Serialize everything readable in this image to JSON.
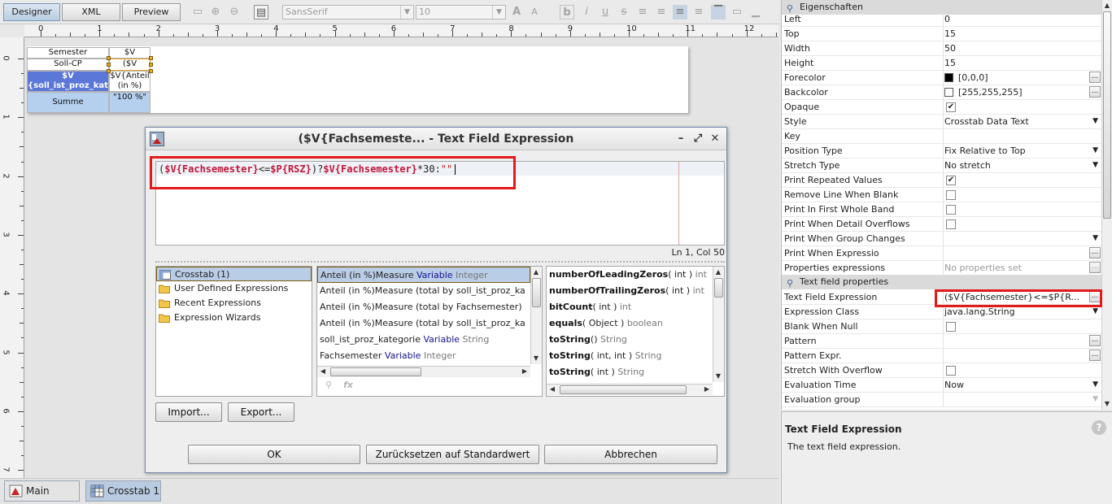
{
  "designer_tabs": [
    "Designer",
    "XML",
    "Preview"
  ],
  "toolbar": {
    "font_family": "SansSerif",
    "font_size": "10"
  },
  "ruler": {
    "h": [
      "0",
      "1",
      "2",
      "3",
      "4",
      "5",
      "6",
      "7",
      "8",
      "9",
      "10",
      "11",
      "12"
    ],
    "v": [
      "0",
      "1",
      "2",
      "3",
      "4",
      "5",
      "6",
      "7"
    ]
  },
  "crosstab": {
    "row1_label": "Semester",
    "row1_value": "$V",
    "row2_label": "Soll-CP",
    "row2_value": "($V",
    "row3_label_a": "$V",
    "row3_label_b": "{soll_ist_proz_kate",
    "row3_value_a": "$V{Anteil",
    "row3_value_b": "(in %)",
    "row4_label": "Summe",
    "row4_value": "\"100 %\""
  },
  "dialog": {
    "title": "($V{Fachsemeste... - Text Field Expression",
    "code": [
      {
        "t": "(",
        "c": "op"
      },
      {
        "t": "$V{Fachsemester}",
        "c": "var"
      },
      {
        "t": "<=",
        "c": "op"
      },
      {
        "t": "$P{RSZ}",
        "c": "var"
      },
      {
        "t": ")?",
        "c": "op"
      },
      {
        "t": "$V{Fachsemester}",
        "c": "var"
      },
      {
        "t": "*30:",
        "c": "op"
      },
      {
        "t": "\"\"",
        "c": "str"
      }
    ],
    "status": "Ln 1, Col 50",
    "tree": [
      "Crosstab (1)",
      "User Defined Expressions",
      "Recent Expressions",
      "Expression Wizards"
    ],
    "variables": [
      {
        "name": "Anteil (in %)Measure",
        "kind": "Variable",
        "type": "Integer"
      },
      {
        "name": "Anteil (in %)Measure (total by soll_ist_proz_ka",
        "kind": "",
        "type": ""
      },
      {
        "name": "Anteil (in %)Measure (total by Fachsemester)",
        "kind": "",
        "type": ""
      },
      {
        "name": "Anteil (in %)Measure (total by soll_ist_proz_ka",
        "kind": "",
        "type": ""
      },
      {
        "name": "soll_ist_proz_kategorie",
        "kind": "Variable",
        "type": "String"
      },
      {
        "name": "Fachsemester",
        "kind": "Variable",
        "type": "Integer"
      }
    ],
    "methods": [
      {
        "name": "numberOfLeadingZeros",
        "args": "( int )",
        "ret": "int"
      },
      {
        "name": "numberOfTrailingZeros",
        "args": "( int )",
        "ret": "int"
      },
      {
        "name": "bitCount",
        "args": "( int )",
        "ret": "int"
      },
      {
        "name": "equals",
        "args": "( Object )",
        "ret": "boolean"
      },
      {
        "name": "toString",
        "args": "()",
        "ret": "String"
      },
      {
        "name": "toString",
        "args": "( int, int )",
        "ret": "String"
      },
      {
        "name": "toString",
        "args": "( int )",
        "ret": "String"
      }
    ],
    "import_label": "Import...",
    "export_label": "Export...",
    "ok_label": "OK",
    "reset_label": "Zurücksetzen auf Standardwert",
    "cancel_label": "Abbrechen"
  },
  "doc_tabs": [
    "Main report",
    "Crosstab 1"
  ],
  "properties": {
    "section_title": "Eigenschaften",
    "rows": [
      {
        "name": "Left",
        "value": "0",
        "kind": "text"
      },
      {
        "name": "Top",
        "value": "15",
        "kind": "text"
      },
      {
        "name": "Width",
        "value": "50",
        "kind": "text"
      },
      {
        "name": "Height",
        "value": "15",
        "kind": "text"
      },
      {
        "name": "Forecolor",
        "value": "[0,0,0]",
        "kind": "color",
        "swatch": "#000000"
      },
      {
        "name": "Backcolor",
        "value": "[255,255,255]",
        "kind": "color",
        "swatch": "#ffffff"
      },
      {
        "name": "Opaque",
        "value": "",
        "kind": "check",
        "checked": true
      },
      {
        "name": "Style",
        "value": "Crosstab Data Text",
        "kind": "combo"
      },
      {
        "name": "Key",
        "value": "",
        "kind": "text"
      },
      {
        "name": "Position Type",
        "value": "Fix Relative to Top",
        "kind": "combo"
      },
      {
        "name": "Stretch Type",
        "value": "No stretch",
        "kind": "combo"
      },
      {
        "name": "Print Repeated Values",
        "value": "",
        "kind": "check",
        "checked": true
      },
      {
        "name": "Remove Line When Blank",
        "value": "",
        "kind": "check",
        "checked": false
      },
      {
        "name": "Print In First Whole Band",
        "value": "",
        "kind": "check",
        "checked": false
      },
      {
        "name": "Print When Detail Overflows",
        "value": "",
        "kind": "check",
        "checked": false
      },
      {
        "name": "Print When Group Changes",
        "value": "",
        "kind": "combo"
      },
      {
        "name": "Print When Expressio",
        "value": "",
        "kind": "ellipsis"
      },
      {
        "name": "Properties expressions",
        "value": "No properties set",
        "kind": "dim-ellipsis"
      }
    ],
    "section2_title": "Text field properties",
    "rows2": [
      {
        "name": "Text Field Expression",
        "value": "($V{Fachsemester}<=$P{R...",
        "kind": "ellipsis"
      },
      {
        "name": "Expression Class",
        "value": "java.lang.String",
        "kind": "combo"
      },
      {
        "name": "Blank When Null",
        "value": "",
        "kind": "check",
        "checked": false
      },
      {
        "name": "Pattern",
        "value": "",
        "kind": "ellipsis"
      },
      {
        "name": "Pattern Expr.",
        "value": "",
        "kind": "ellipsis"
      },
      {
        "name": "Stretch With Overflow",
        "value": "",
        "kind": "check",
        "checked": false
      },
      {
        "name": "Evaluation Time",
        "value": "Now",
        "kind": "combo"
      },
      {
        "name": "Evaluation group",
        "value": "",
        "kind": "combo-dim"
      }
    ]
  },
  "help": {
    "title": "Text Field Expression",
    "description": "The text field expression."
  }
}
